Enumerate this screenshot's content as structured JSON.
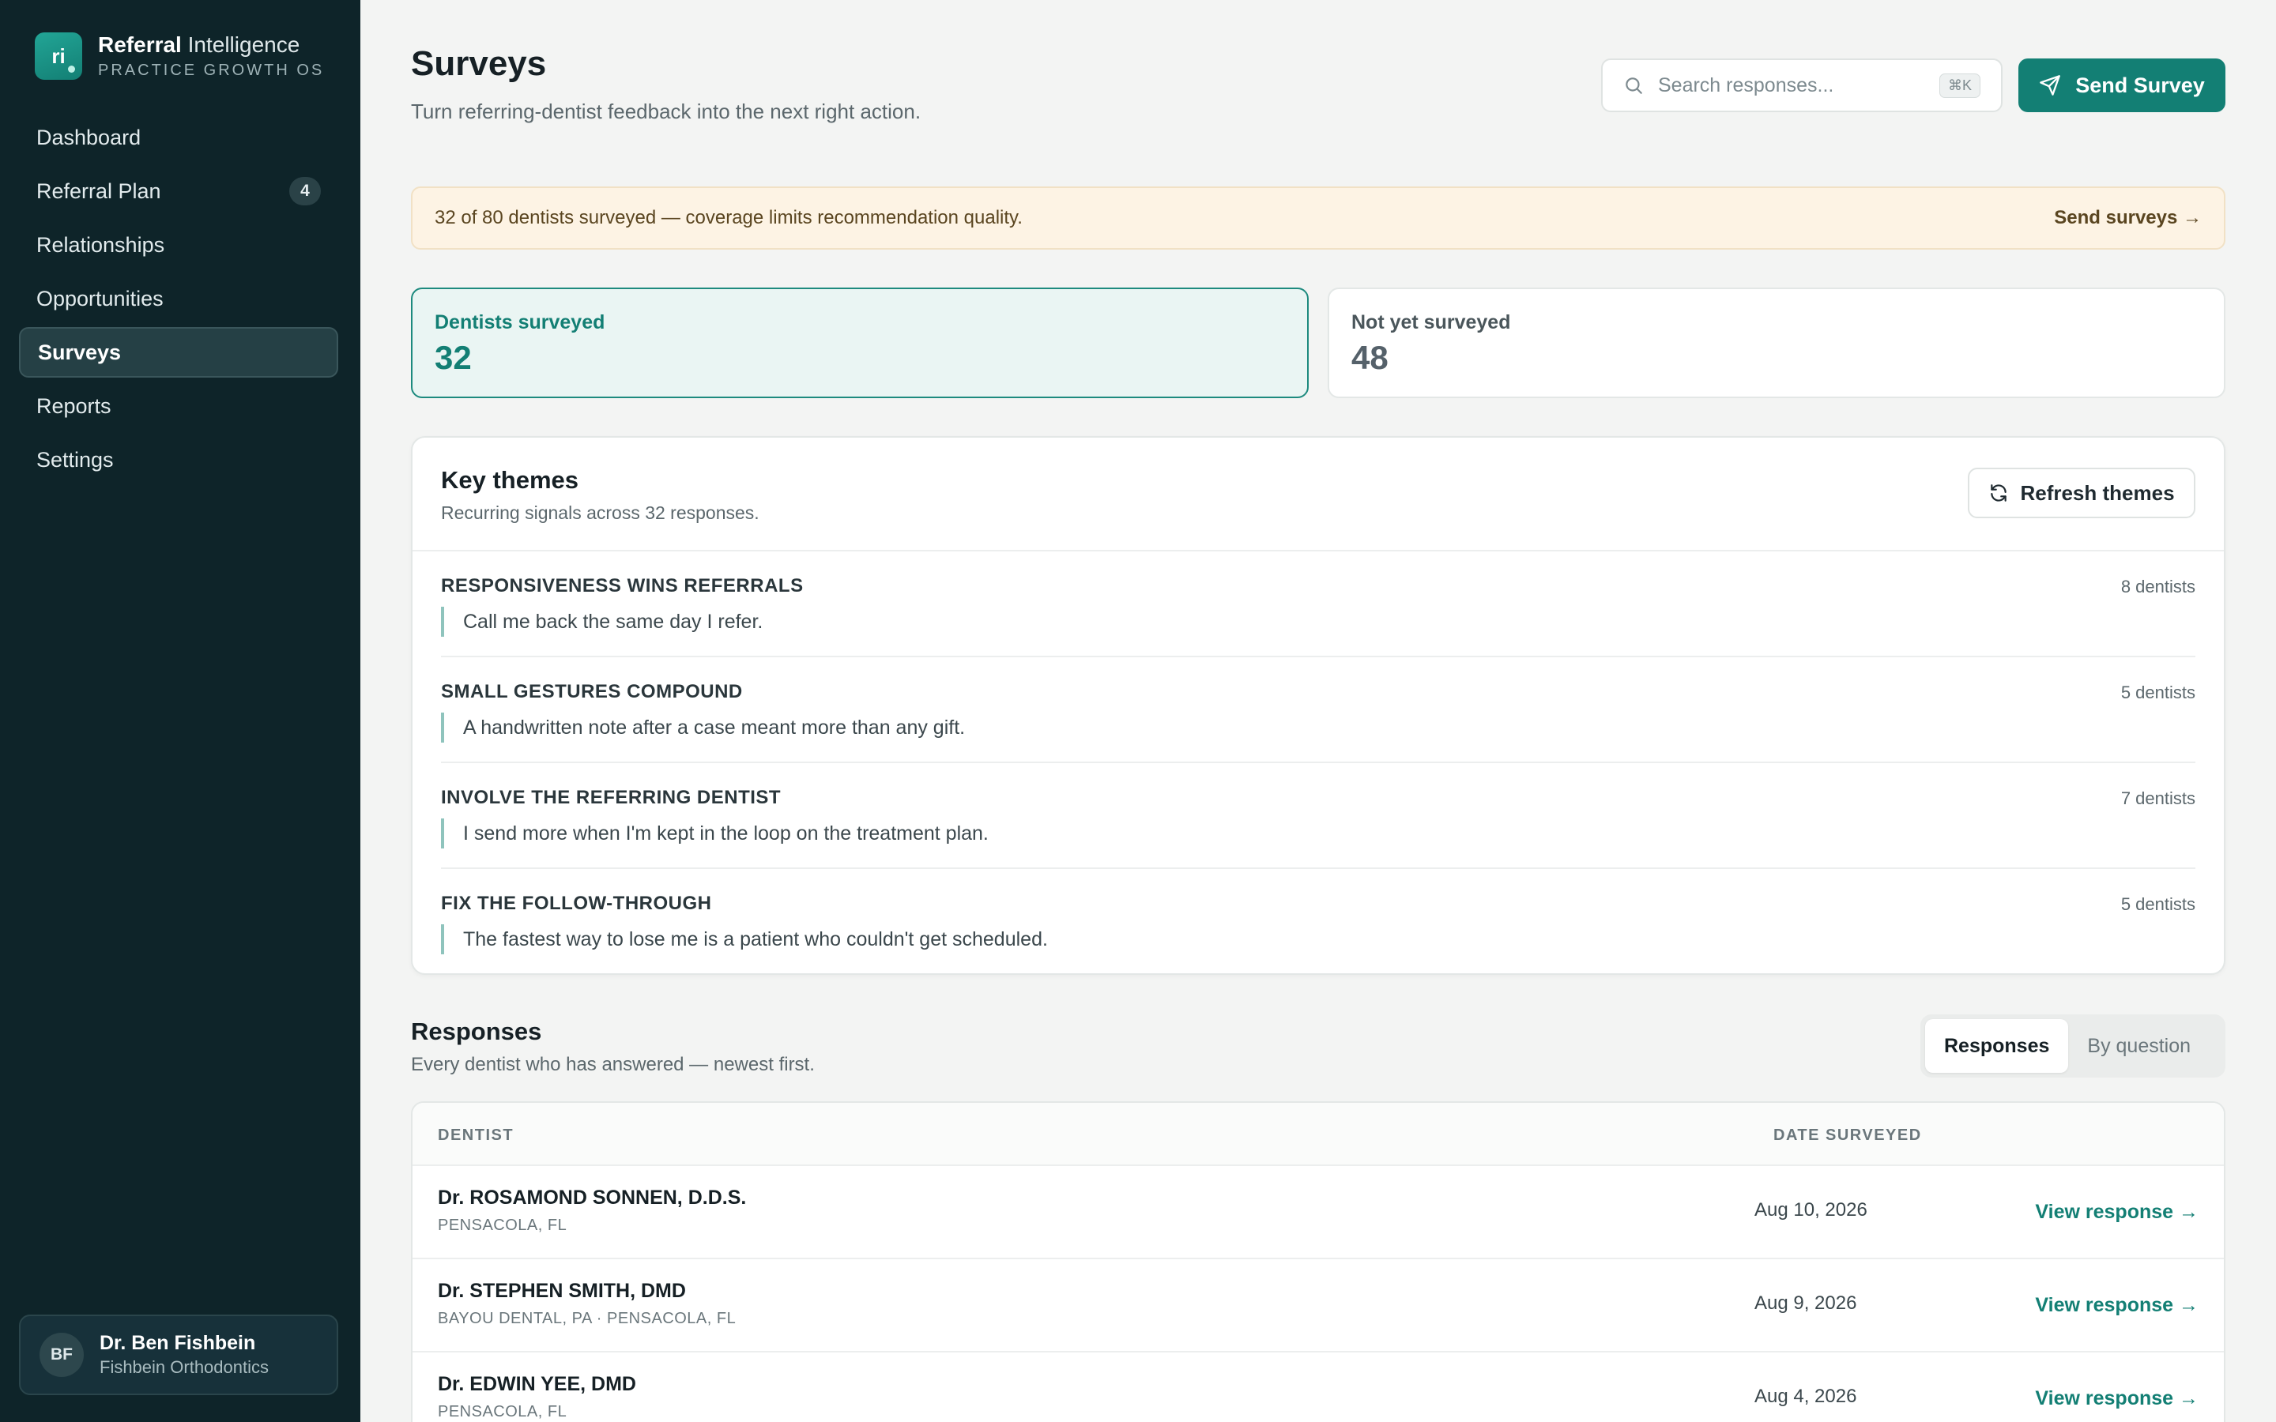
{
  "brand": {
    "logo_text": "ri",
    "name_bold": "Referral",
    "name_rest": "Intelligence",
    "tagline": "PRACTICE GROWTH OS"
  },
  "nav": [
    {
      "label": "Dashboard"
    },
    {
      "label": "Referral Plan",
      "badge": "4"
    },
    {
      "label": "Relationships"
    },
    {
      "label": "Opportunities"
    },
    {
      "label": "Surveys",
      "active": true
    },
    {
      "label": "Reports"
    },
    {
      "label": "Settings"
    }
  ],
  "user": {
    "initials": "BF",
    "name": "Dr. Ben Fishbein",
    "org": "Fishbein Orthodontics"
  },
  "header": {
    "title": "Surveys",
    "subtitle": "Turn referring-dentist feedback into the next right action.",
    "search_placeholder": "Search responses...",
    "search_shortcut": "⌘K",
    "send_label": "Send Survey"
  },
  "banner": {
    "text": "32 of 80 dentists surveyed — coverage limits recommendation quality.",
    "link": "Send surveys →"
  },
  "stats": {
    "surveyed_label": "Dentists surveyed",
    "surveyed_value": "32",
    "not_label": "Not yet surveyed",
    "not_value": "48"
  },
  "themes": {
    "title": "Key themes",
    "subtitle": "Recurring signals across 32 responses.",
    "refresh_label": "Refresh themes",
    "items": [
      {
        "title": "RESPONSIVENESS WINS REFERRALS",
        "count": "8 dentists",
        "quote": "Call me back the same day I refer."
      },
      {
        "title": "SMALL GESTURES COMPOUND",
        "count": "5 dentists",
        "quote": "A handwritten note after a case meant more than any gift."
      },
      {
        "title": "INVOLVE THE REFERRING DENTIST",
        "count": "7 dentists",
        "quote": "I send more when I'm kept in the loop on the treatment plan."
      },
      {
        "title": "FIX THE FOLLOW-THROUGH",
        "count": "5 dentists",
        "quote": "The fastest way to lose me is a patient who couldn't get scheduled."
      }
    ]
  },
  "responses": {
    "title": "Responses",
    "subtitle": "Every dentist who has answered — newest first.",
    "tab_responses": "Responses",
    "tab_by_question": "By question",
    "col_dentist": "DENTIST",
    "col_date": "DATE SURVEYED",
    "rows": [
      {
        "name": "Dr. ROSAMOND SONNEN, D.D.S.",
        "location": "PENSACOLA, FL",
        "date": "Aug 10, 2026",
        "link": "View response →"
      },
      {
        "name": "Dr. STEPHEN SMITH, DMD",
        "location": "BAYOU DENTAL, PA · PENSACOLA, FL",
        "date": "Aug 9, 2026",
        "link": "View response →"
      },
      {
        "name": "Dr. EDWIN YEE, DMD",
        "location": "PENSACOLA, FL",
        "date": "Aug 4, 2026",
        "link": "View response →"
      }
    ]
  },
  "colors": {
    "sidebar": "#0e2429",
    "accent": "#137f74",
    "banner_bg": "#fdf3e4"
  }
}
